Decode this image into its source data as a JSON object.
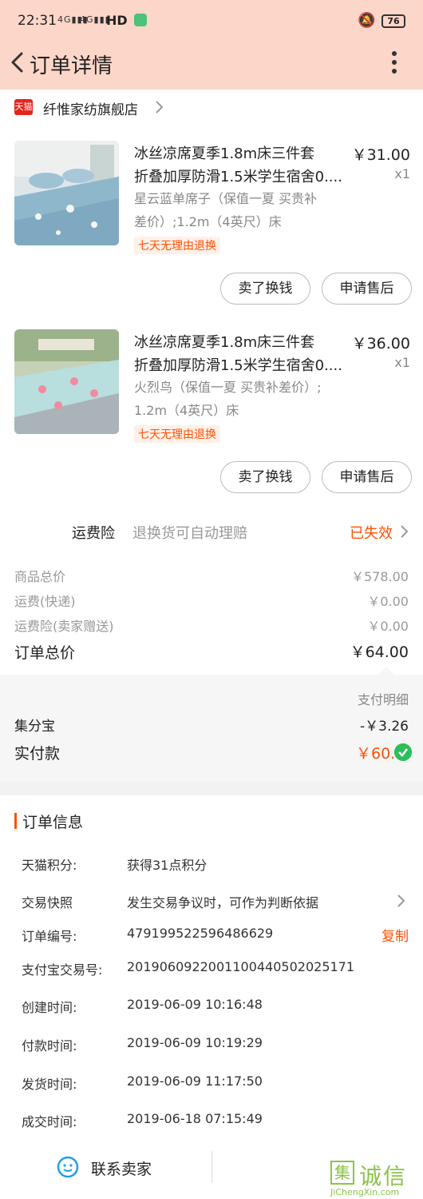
{
  "status_bar": {
    "time": "22:31",
    "signal1": "4G",
    "signal2": "4G",
    "hd": "HD",
    "battery": "76"
  },
  "header": {
    "title": "订单详情"
  },
  "shop": {
    "name": "纤惟家纺旗舰店",
    "badge": "天猫"
  },
  "items": [
    {
      "title_line1": "冰丝凉席夏季1.8m床三件套",
      "title_line2": "折叠加厚防滑1.5米学生宿舍0....",
      "spec_line1": "星云蓝单席子（保值一夏 买贵补",
      "spec_line2": "差价）;1.2m（4英尺）床",
      "tag": "七天无理由退换",
      "price": "￥31.00",
      "qty": "x1",
      "sell_label": "卖了换钱",
      "after_label": "申请售后"
    },
    {
      "title_line1": "冰丝凉席夏季1.8m床三件套",
      "title_line2": "折叠加厚防滑1.5米学生宿舍0....",
      "spec_line1": "火烈鸟（保值一夏 买贵补差价）;",
      "spec_line2": "1.2m（4英尺）床",
      "tag": "七天无理由退换",
      "price": "￥36.00",
      "qty": "x1",
      "sell_label": "卖了换钱",
      "after_label": "申请售后"
    }
  ],
  "insurance": {
    "label": "运费险",
    "desc": "退换货可自动理赔",
    "status": "已失效"
  },
  "fees": [
    {
      "label": "商品总价",
      "value": "￥578.00"
    },
    {
      "label": "运费(快递)",
      "value": "￥0.00"
    },
    {
      "label": "运费险(卖家赠送)",
      "value": "￥0.00"
    }
  ],
  "total": {
    "label": "订单总价",
    "value": "￥64.00"
  },
  "payment": {
    "detail_label": "支付明细",
    "jifen_label": "集分宝",
    "jifen_value": "-￥3.26",
    "paid_label": "实付款",
    "paid_value": "￥60."
  },
  "info": {
    "title": "订单信息",
    "rows": [
      {
        "key": "天猫积分:",
        "value": "获得31点积分"
      },
      {
        "key": "交易快照",
        "value": "发生交易争议时，可作为判断依据"
      },
      {
        "key": "订单编号:",
        "value": "479199522596486629"
      },
      {
        "key": "支付宝交易号:",
        "value": "2019060922001100440502025171"
      },
      {
        "key": "创建时间:",
        "value": "2019-06-09 10:16:48"
      },
      {
        "key": "付款时间:",
        "value": "2019-06-09 10:19:29"
      },
      {
        "key": "发货时间:",
        "value": "2019-06-09 11:17:50"
      },
      {
        "key": "成交时间:",
        "value": "2019-06-18 07:15:49"
      }
    ],
    "copy_label": "复制"
  },
  "bottom": {
    "contact_label": "联系卖家"
  },
  "watermark": {
    "text": "诚信",
    "icon_char": "集",
    "url": "JiChengXin.com"
  },
  "colors": {
    "accent": "#ff5000",
    "header_bg": "#fcd6c8",
    "tmall_red": "#e4251b",
    "success_green": "#2bbf5a"
  }
}
